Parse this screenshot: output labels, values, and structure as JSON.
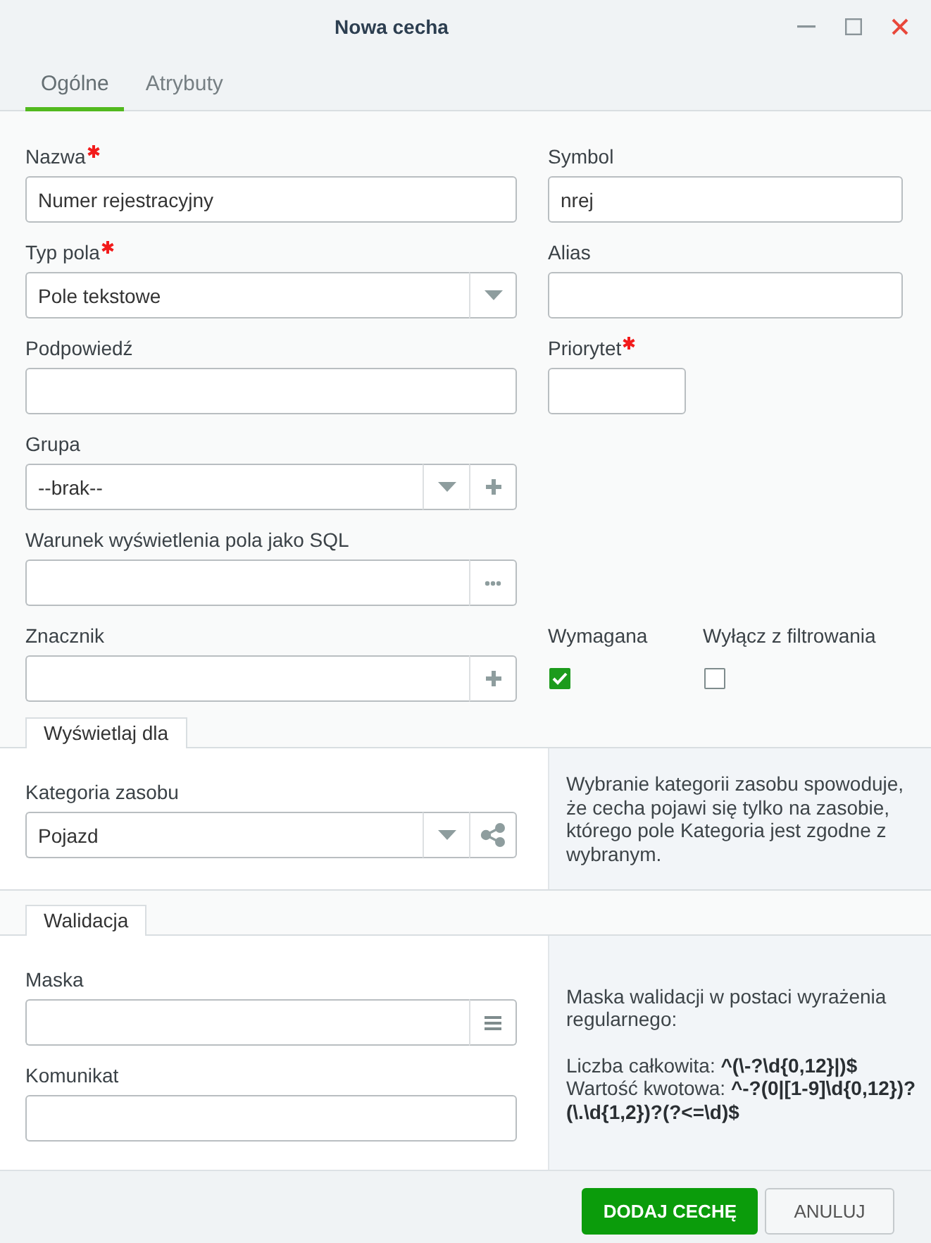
{
  "window": {
    "title": "Nowa cecha"
  },
  "tabs": [
    {
      "label": "Ogólne",
      "selected": true
    },
    {
      "label": "Atrybuty",
      "selected": false
    }
  ],
  "rows": [
    {
      "left": {
        "kind": "text",
        "label": "Nazwa",
        "required": true,
        "value": "Numer rejestracyjny"
      },
      "right": {
        "kind": "text",
        "label": "Symbol",
        "required": false,
        "value": "nrej"
      }
    },
    {
      "left": {
        "kind": "text",
        "label": "Typ pola",
        "required": true,
        "value": "Pole tekstowe",
        "buttons": [
          {
            "kind": "dropdown"
          }
        ]
      },
      "right": {
        "kind": "text",
        "label": "Alias",
        "required": false
      }
    },
    {
      "left": {
        "kind": "text",
        "label": "Podpowiedź",
        "required": false
      },
      "right": {
        "kind": "short",
        "label": "Priorytet",
        "required": true
      }
    },
    {
      "left": {
        "kind": "text",
        "label": "Grupa",
        "required": false,
        "value": "--brak--",
        "buttons": [
          {
            "kind": "dropdown"
          },
          {
            "kind": "add"
          }
        ]
      }
    },
    {
      "left": {
        "kind": "text",
        "label": "Warunek wyświetlenia pola jako SQL",
        "required": false,
        "buttons": [
          {
            "kind": "more"
          }
        ]
      }
    },
    {
      "left": {
        "kind": "text",
        "label": "Znacznik",
        "required": false,
        "buttons": [
          {
            "kind": "add"
          }
        ]
      },
      "right": {
        "kind": "checkboxes",
        "items": [
          {
            "label": "Wymagana",
            "checked": true
          },
          {
            "label": "Wyłącz z filtrowania",
            "checked": false
          }
        ]
      }
    }
  ],
  "sections": [
    {
      "title": "Wyświetlaj dla",
      "fields": [
        {
          "kind": "text",
          "label": "Kategoria zasobu",
          "required": false,
          "value": "Pojazd",
          "buttons": [
            {
              "kind": "dropdown"
            },
            {
              "kind": "share"
            }
          ]
        }
      ],
      "help": [
        [
          "Wybranie kategorii zasobu spowoduje, że cecha pojawi się tylko na zasobie, którego pole Kategoria jest zgodne z wybranym."
        ]
      ]
    },
    {
      "title": "Walidacja",
      "fields": [
        {
          "kind": "text",
          "label": "Maska",
          "required": false,
          "buttons": [
            {
              "kind": "list"
            }
          ]
        },
        {
          "kind": "text",
          "label": "Komunikat",
          "required": false
        }
      ],
      "help": [
        [
          "Maska walidacji w postaci wyrażenia regularnego:"
        ],
        [
          "Liczba całkowita: **^(\\-?\\d{0,12}|)$**",
          "Wartość kwotowa: **^-?(0|[1-9]\\d{0,12})?(\\.\\d{1,2})?(?<=\\d)$**"
        ]
      ]
    }
  ],
  "footer": {
    "buttons": [
      {
        "label": "DODAJ CECHĘ",
        "kind": "primary"
      },
      {
        "label": "ANULUJ",
        "kind": "secondary"
      }
    ]
  }
}
